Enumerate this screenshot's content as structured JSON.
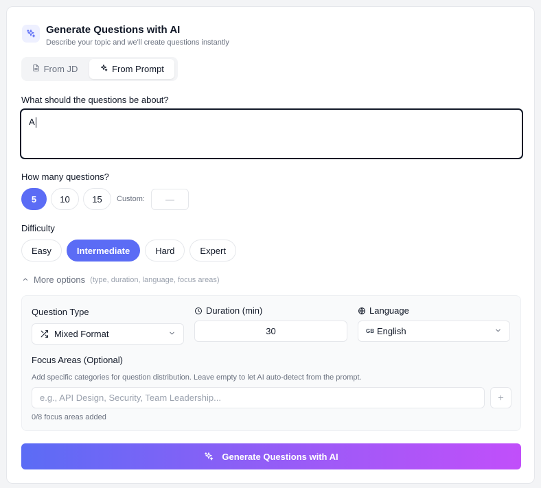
{
  "header": {
    "title": "Generate Questions with AI",
    "subtitle": "Describe your topic and we'll create questions instantly",
    "icon": "sparkles-icon"
  },
  "mode_tabs": [
    {
      "label": "From JD",
      "icon": "document-icon",
      "active": false
    },
    {
      "label": "From Prompt",
      "icon": "sparkles-icon",
      "active": true
    }
  ],
  "topic": {
    "label": "What should the questions be about?",
    "value": "A"
  },
  "count": {
    "label": "How many questions?",
    "options": [
      "5",
      "10",
      "15"
    ],
    "selected": "5",
    "custom_label": "Custom:",
    "custom_value": "—"
  },
  "difficulty": {
    "label": "Difficulty",
    "options": [
      "Easy",
      "Intermediate",
      "Hard",
      "Expert"
    ],
    "selected": "Intermediate"
  },
  "more_options": {
    "label": "More options",
    "hint": "(type, duration, language, focus areas)",
    "expanded": true
  },
  "options": {
    "question_type": {
      "label": "Question Type",
      "value": "Mixed Format",
      "icon": "shuffle-icon"
    },
    "duration": {
      "label": "Duration (min)",
      "value": "30",
      "icon": "clock-icon"
    },
    "language": {
      "label": "Language",
      "value": "English",
      "flag": "GB",
      "icon": "globe-icon"
    },
    "focus": {
      "label": "Focus Areas (Optional)",
      "description": "Add specific categories for question distribution. Leave empty to let AI auto-detect from the prompt.",
      "placeholder": "e.g., API Design, Security, Team Leadership...",
      "count_text": "0/8 focus areas added"
    }
  },
  "generate_button": {
    "label": "Generate Questions with AI"
  },
  "colors": {
    "accent": "#5b6cf5",
    "gradient_end": "#c14ffa"
  }
}
